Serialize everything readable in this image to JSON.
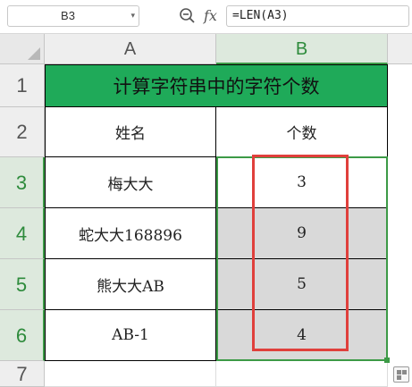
{
  "formula_bar": {
    "cell_ref": "B3",
    "fx_label": "fx",
    "formula": "=LEN(A3)"
  },
  "columns": [
    "A",
    "B"
  ],
  "rows": [
    "1",
    "2",
    "3",
    "4",
    "5",
    "6",
    "7"
  ],
  "table": {
    "title": "计算字符串中的字符个数",
    "headers": [
      "姓名",
      "个数"
    ],
    "data": [
      {
        "name": "梅大大",
        "count": "3"
      },
      {
        "name": "蛇大大168896",
        "count": "9"
      },
      {
        "name": "熊大大AB",
        "count": "5"
      },
      {
        "name": "AB-1",
        "count": "4"
      }
    ]
  },
  "colors": {
    "title_fill": "#1faa59",
    "selection": "#3c9a46",
    "highlight_box": "#e0403c"
  },
  "icons": [
    "zoom-icon",
    "fx-icon",
    "dropdown-arrow-icon",
    "quick-analysis-icon"
  ]
}
